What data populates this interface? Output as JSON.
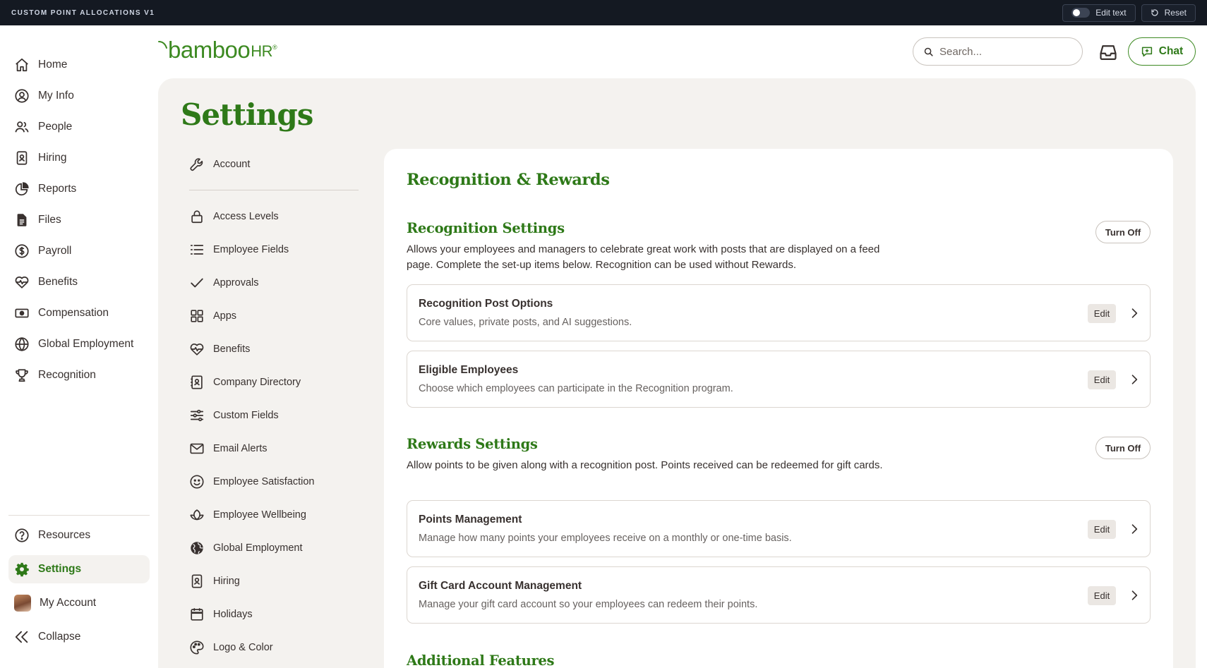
{
  "topbar": {
    "project": "CUSTOM POINT ALLOCATIONS V1",
    "edit_text": "Edit text",
    "reset": "Reset"
  },
  "nav": {
    "items": [
      {
        "label": "Home",
        "icon": "home-icon"
      },
      {
        "label": "My Info",
        "icon": "user-circle-icon"
      },
      {
        "label": "People",
        "icon": "people-icon"
      },
      {
        "label": "Hiring",
        "icon": "badge-icon"
      },
      {
        "label": "Reports",
        "icon": "pie-chart-icon"
      },
      {
        "label": "Files",
        "icon": "file-icon"
      },
      {
        "label": "Payroll",
        "icon": "dollar-circle-icon"
      },
      {
        "label": "Benefits",
        "icon": "heart-pulse-icon"
      },
      {
        "label": "Compensation",
        "icon": "cash-icon"
      },
      {
        "label": "Global Employment",
        "icon": "globe-icon"
      },
      {
        "label": "Recognition",
        "icon": "trophy-icon"
      }
    ],
    "bottom": [
      {
        "label": "Resources",
        "icon": "question-circle-icon"
      },
      {
        "label": "Settings",
        "icon": "gear-icon",
        "active": true
      },
      {
        "label": "My Account",
        "icon": "avatar"
      },
      {
        "label": "Collapse",
        "icon": "double-chevron-left-icon"
      }
    ]
  },
  "header": {
    "logo_main": "bamboo",
    "logo_hr": "HR",
    "logo_reg": "®",
    "search_placeholder": "Search...",
    "chat_label": "Chat"
  },
  "page_title": "Settings",
  "settings_nav": {
    "top": {
      "label": "Account",
      "icon": "wrench-icon"
    },
    "items": [
      {
        "label": "Access Levels",
        "icon": "lock-icon"
      },
      {
        "label": "Employee Fields",
        "icon": "list-icon"
      },
      {
        "label": "Approvals",
        "icon": "check-icon"
      },
      {
        "label": "Apps",
        "icon": "grid-icon"
      },
      {
        "label": "Benefits",
        "icon": "heart-pulse-icon"
      },
      {
        "label": "Company Directory",
        "icon": "contact-book-icon"
      },
      {
        "label": "Custom Fields",
        "icon": "sliders-icon"
      },
      {
        "label": "Email Alerts",
        "icon": "envelope-icon"
      },
      {
        "label": "Employee Satisfaction",
        "icon": "smile-icon"
      },
      {
        "label": "Employee Wellbeing",
        "icon": "lotus-icon"
      },
      {
        "label": "Global Employment",
        "icon": "globe-filled-icon"
      },
      {
        "label": "Hiring",
        "icon": "badge-icon"
      },
      {
        "label": "Holidays",
        "icon": "calendar-icon"
      },
      {
        "label": "Logo & Color",
        "icon": "palette-icon"
      }
    ]
  },
  "content": {
    "title": "Recognition & Rewards",
    "recognition": {
      "heading": "Recognition Settings",
      "turn_off": "Turn Off",
      "description": "Allows your employees and managers to celebrate great work with posts that are displayed on a feed page. Complete the set-up items below. Recognition can be used without Rewards.",
      "rows": [
        {
          "title": "Recognition Post Options",
          "subtitle": "Core values, private posts, and AI suggestions.",
          "edit": "Edit"
        },
        {
          "title": "Eligible Employees",
          "subtitle": "Choose which employees can participate in the Recognition program.",
          "edit": "Edit"
        }
      ]
    },
    "rewards": {
      "heading": "Rewards Settings",
      "turn_off": "Turn Off",
      "description": "Allow points to be given along with a recognition post. Points received can be redeemed for gift cards.",
      "rows": [
        {
          "title": "Points Management",
          "subtitle": "Manage how many points your employees receive on a monthly or one-time basis.",
          "edit": "Edit"
        },
        {
          "title": "Gift Card Account Management",
          "subtitle": "Manage your gift card account so your employees can redeem their points.",
          "edit": "Edit"
        }
      ]
    },
    "additional_heading": "Additional Features"
  },
  "colors": {
    "brand_green": "#2e7918",
    "logo_green": "#3d8a22",
    "topbar": "#141922",
    "panel": "#f4f2ef"
  }
}
